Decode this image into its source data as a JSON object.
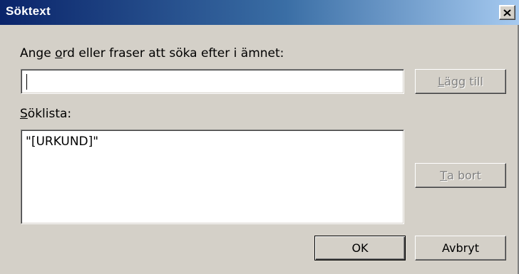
{
  "dialog": {
    "title": "Söktext",
    "close_icon": "close-icon"
  },
  "search": {
    "prompt_before": "Ange ",
    "prompt_mnemonic": "o",
    "prompt_after": "rd eller fraser att söka efter i ämnet:",
    "input_value": ""
  },
  "list": {
    "label_mnemonic": "S",
    "label_rest": "öklista:",
    "items": [
      "\"[URKUND]\""
    ]
  },
  "buttons": {
    "add": {
      "mnemonic": "L",
      "rest": "ägg till"
    },
    "remove": {
      "mnemonic": "T",
      "rest": "a bort"
    },
    "ok": "OK",
    "cancel": "Avbryt"
  }
}
